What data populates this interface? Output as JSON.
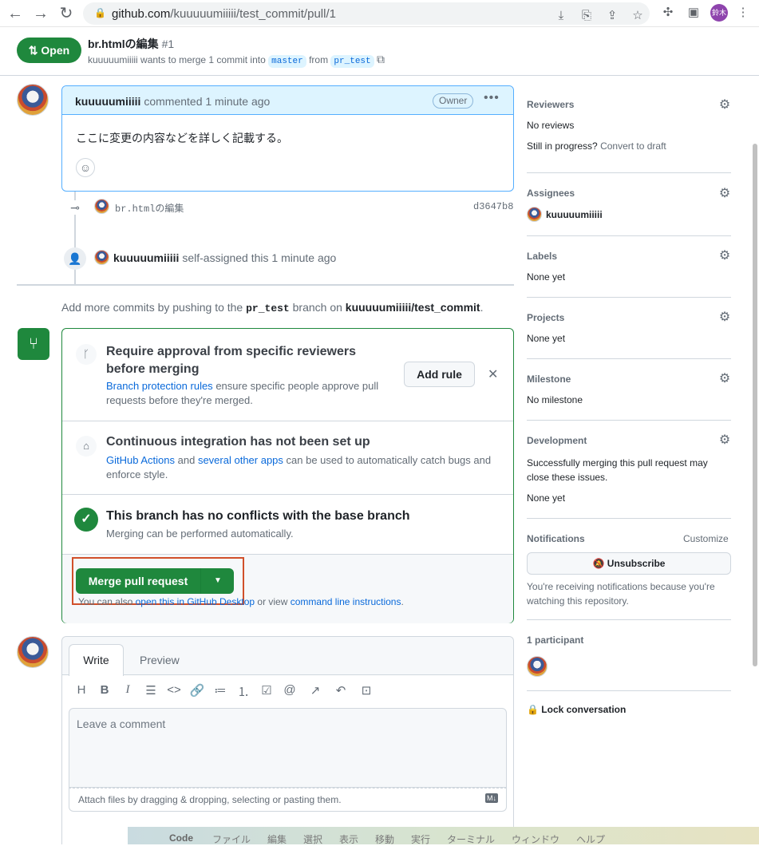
{
  "browser": {
    "url_domain": "github.com",
    "url_path": "/kuuuuumiiiii/test_commit/pull/1",
    "avatar_text": "鈴木",
    "avatar_color": "#8e44ad"
  },
  "pr": {
    "status": "Open",
    "title": "br.htmlの編集",
    "number": "#1",
    "author": "kuuuuumiiiii",
    "summary_pre": "wants to merge 1 commit into",
    "base": "master",
    "from": "from",
    "head": "pr_test"
  },
  "comment": {
    "author": "kuuuuumiiiii",
    "meta": "commented 1 minute ago",
    "role": "Owner",
    "body": "ここに変更の内容などを詳しく記載する。"
  },
  "commit": {
    "message": "br.htmlの編集",
    "sha": "d3647b8"
  },
  "event": {
    "actor": "kuuuuumiiiii",
    "text": "self-assigned this 1 minute ago"
  },
  "hint": {
    "pre": "Add more commits by pushing to the",
    "branch": "pr_test",
    "mid": "branch on",
    "repo": "kuuuuumiiiii/test_commit",
    "end": "."
  },
  "merge": {
    "rule_title": "Require approval from specific reviewers before merging",
    "rule_link": "Branch protection rules",
    "rule_desc": "ensure specific people approve pull requests before they're merged.",
    "add_rule": "Add rule",
    "ci_title": "Continuous integration has not been set up",
    "ci_link1": "GitHub Actions",
    "ci_and": "and",
    "ci_link2": "several other apps",
    "ci_desc": "can be used to automatically catch bugs and enforce style.",
    "conf_title": "This branch has no conflicts with the base branch",
    "conf_desc": "Merging can be performed automatically.",
    "button": "Merge pull request",
    "also_pre": "You can also",
    "also_link": "open this in GitHub Desktop",
    "also_mid": "or view",
    "also_link2": "command line instructions",
    "also_end": "."
  },
  "editor": {
    "tab_write": "Write",
    "tab_preview": "Preview",
    "placeholder": "Leave a comment",
    "attach": "Attach files by dragging & dropping, selecting or pasting them."
  },
  "sidebar": {
    "reviewers_title": "Reviewers",
    "reviewers_value": "No reviews",
    "progress": "Still in progress?",
    "convert": "Convert to draft",
    "assignees_title": "Assignees",
    "assignee": "kuuuuumiiiii",
    "labels_title": "Labels",
    "labels_value": "None yet",
    "projects_title": "Projects",
    "projects_value": "None yet",
    "milestone_title": "Milestone",
    "milestone_value": "No milestone",
    "dev_title": "Development",
    "dev_desc": "Successfully merging this pull request may close these issues.",
    "dev_value": "None yet",
    "notif_title": "Notifications",
    "customize": "Customize",
    "unsubscribe": "Unsubscribe",
    "notif_desc": "You're receiving notifications because you're watching this repository.",
    "participants": "1 participant",
    "lock": "Lock conversation"
  },
  "macbar": {
    "app": "Code",
    "items": [
      "ファイル",
      "編集",
      "選択",
      "表示",
      "移動",
      "実行",
      "ターミナル",
      "ウィンドウ",
      "ヘルプ"
    ]
  },
  "colors": {
    "green": "#1f883d",
    "link": "#0969da",
    "highlight": "#d1502a"
  }
}
